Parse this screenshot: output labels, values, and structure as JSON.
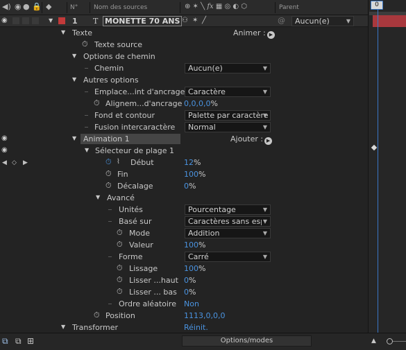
{
  "header": {
    "col_num": "N°",
    "col_source": "Nom des sources",
    "col_parent": "Parent",
    "col_switches": "⁠✶ \\ fx"
  },
  "timeline": {
    "cti_label": "0"
  },
  "layer": {
    "number": "1",
    "type_icon": "T",
    "name": "MONETTE 70 ANS",
    "parent": "Aucun(e)"
  },
  "rows": {
    "texte": "Texte",
    "animer": "Animer :",
    "texte_source": "Texte source",
    "options_chemin": "Options de chemin",
    "chemin": "Chemin",
    "chemin_value": "Aucun(e)",
    "autres_options": "Autres options",
    "emplacement": "Emplace...int d'ancrage",
    "emplacement_value": "Caractère",
    "alignement": "Alignem...d'ancrage",
    "alignement_value": "0,0,0,0",
    "alignement_unit": "%",
    "fond": "Fond et contour",
    "fond_value": "Palette par caractère",
    "fusion": "Fusion intercaractère",
    "fusion_value": "Normal",
    "animation": "Animation 1",
    "ajouter": "Ajouter :",
    "selecteur": "Sélecteur de plage 1",
    "debut": "Début",
    "debut_value": "12",
    "debut_unit": "%",
    "fin": "Fin",
    "fin_value": "100",
    "fin_unit": "%",
    "decalage": "Décalage",
    "decalage_value": "0",
    "decalage_unit": "%",
    "avance": "Avancé",
    "unites": "Unités",
    "unites_value": "Pourcentage",
    "base": "Basé sur",
    "base_value": "Caractères sans esp",
    "mode": "Mode",
    "mode_value": "Addition",
    "valeur": "Valeur",
    "valeur_value": "100",
    "valeur_unit": "%",
    "forme": "Forme",
    "forme_value": "Carré",
    "lissage": "Lissage",
    "lissage_value": "100",
    "lissage_unit": "%",
    "lisser_haut": "Lisser ...haut",
    "lisser_haut_value": "0",
    "lisser_haut_unit": "%",
    "lisser_bas": "Lisser ... bas",
    "lisser_bas_value": "0",
    "lisser_bas_unit": "%",
    "ordre": "Ordre aléatoire",
    "ordre_value": "Non",
    "position": "Position",
    "position_value": "1113,0,0,0",
    "transformer": "Transformer",
    "reinit": "Réinit."
  },
  "footer": {
    "options_modes": "Options/modes"
  },
  "colors": {
    "accent_blue": "#4a93e0",
    "layer_label": "#c23a3a",
    "timeline_bar": "#a8383d"
  }
}
